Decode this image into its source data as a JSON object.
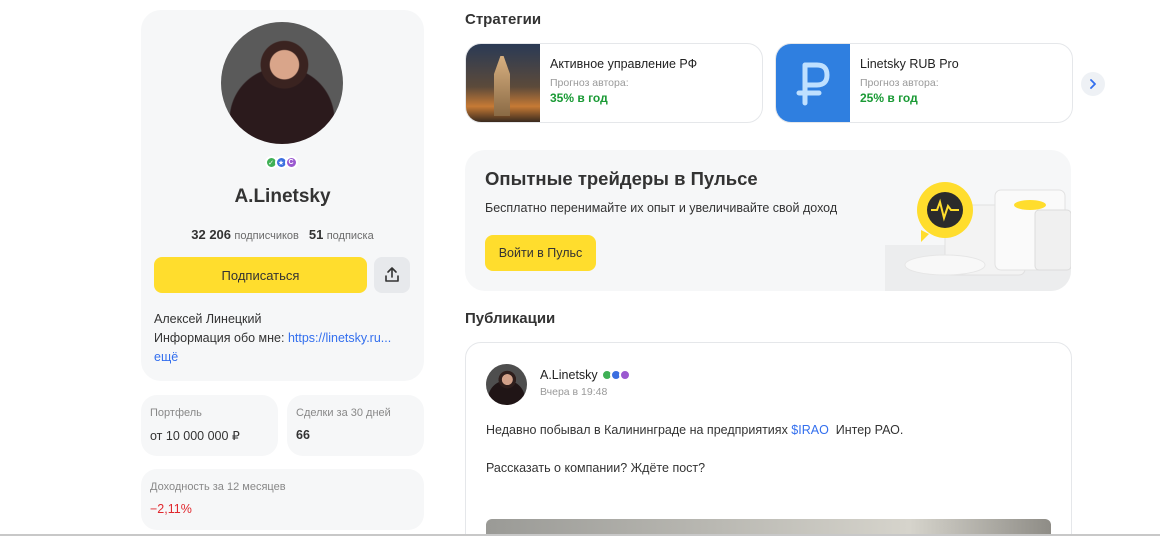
{
  "profile": {
    "name": "A.Linetsky",
    "subscribers_count": "32 206",
    "subscribers_label": "подписчиков",
    "subscriptions_count": "51",
    "subscriptions_label": "подписка",
    "subscribe_label": "Подписаться",
    "bio_name": "Алексей Линецкий",
    "bio_info_prefix": "Информация обо мне: ",
    "bio_link": "https://linetsky.ru...",
    "bio_more": "ещё"
  },
  "stats": {
    "portfolio": {
      "label": "Портфель",
      "value": "от 10 000 000 ₽"
    },
    "deals": {
      "label": "Сделки за 30 дней",
      "value": "66"
    },
    "yield": {
      "label": "Доходность за 12 месяцев",
      "value": "−2,11%"
    }
  },
  "strategies": {
    "title": "Стратегии",
    "items": [
      {
        "name": "Активное управление РФ",
        "forecast_label": "Прогноз автора:",
        "rate": "35% в год"
      },
      {
        "name": "Linetsky RUB Pro",
        "forecast_label": "Прогноз автора:",
        "rate": "25% в год"
      }
    ]
  },
  "promo": {
    "title": "Опытные трейдеры в Пульсе",
    "description": "Бесплатно перенимайте их опыт и увеличивайте свой доход",
    "button": "Войти в Пульс"
  },
  "publications": {
    "title": "Публикации",
    "post": {
      "author": "A.Linetsky",
      "time": "Вчера в 19:48",
      "text_before": "Недавно побывал в Калининграде на предприятиях ",
      "ticker": "$IRAO",
      "text_after": "  Интер РАО.",
      "text2": "Рассказать о компании? Ждёте пост?"
    }
  },
  "colors": {
    "accent_yellow": "#ffdd2d",
    "link_blue": "#336fee",
    "positive_green": "#1a9a35",
    "negative_red": "#e0282e"
  }
}
